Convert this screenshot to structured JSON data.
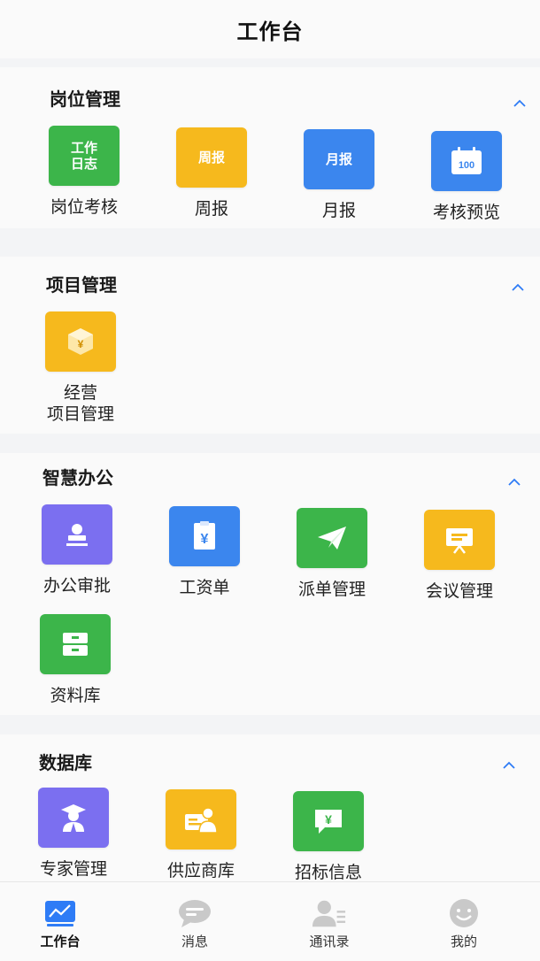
{
  "header": {
    "title": "工作台"
  },
  "sections": [
    {
      "title": "岗位管理",
      "items": [
        {
          "label": "岗位考核",
          "icon_text": "工作\n日志",
          "icon": "work-log-icon",
          "color": "#3cb54a"
        },
        {
          "label": "周报",
          "icon_text": "周报",
          "icon": "weekly-report-icon",
          "color": "#f6b91d"
        },
        {
          "label": "月报",
          "icon_text": "月报",
          "icon": "monthly-report-icon",
          "color": "#3b86ee"
        },
        {
          "label": "考核预览",
          "icon_text": "100",
          "icon": "score-calendar-icon",
          "color": "#3b86ee"
        }
      ]
    },
    {
      "title": "项目管理",
      "items": [
        {
          "label": "经营\n项目管理",
          "icon": "yen-box-icon",
          "color": "#f6b91d"
        }
      ]
    },
    {
      "title": "智慧办公",
      "items": [
        {
          "label": "办公审批",
          "icon": "stamp-icon",
          "color": "#7b6ff0"
        },
        {
          "label": "工资单",
          "icon": "payslip-icon",
          "color": "#3b86ee"
        },
        {
          "label": "派单管理",
          "icon": "paper-plane-icon",
          "color": "#3cb54a"
        },
        {
          "label": "会议管理",
          "icon": "presentation-icon",
          "color": "#f6b91d"
        },
        {
          "label": "资料库",
          "icon": "cabinet-icon",
          "color": "#3cb54a"
        }
      ]
    },
    {
      "title": "数据库",
      "items": [
        {
          "label": "专家管理",
          "icon": "graduate-icon",
          "color": "#7b6ff0"
        },
        {
          "label": "供应商库",
          "icon": "supplier-card-icon",
          "color": "#f6b91d"
        },
        {
          "label": "招标信息",
          "icon": "yen-message-icon",
          "color": "#3cb54a"
        }
      ]
    }
  ],
  "tabbar": {
    "tabs": [
      {
        "label": "工作台",
        "icon": "chart-icon",
        "active": true
      },
      {
        "label": "消息",
        "icon": "message-icon",
        "active": false
      },
      {
        "label": "通讯录",
        "icon": "contacts-icon",
        "active": false
      },
      {
        "label": "我的",
        "icon": "smiley-icon",
        "active": false
      }
    ]
  },
  "colors": {
    "accent": "#2e7cf6",
    "green": "#3cb54a",
    "yellow": "#f6b91d",
    "blue": "#3b86ee",
    "purple": "#7b6ff0",
    "inactive_icon": "#c9c9c9"
  }
}
